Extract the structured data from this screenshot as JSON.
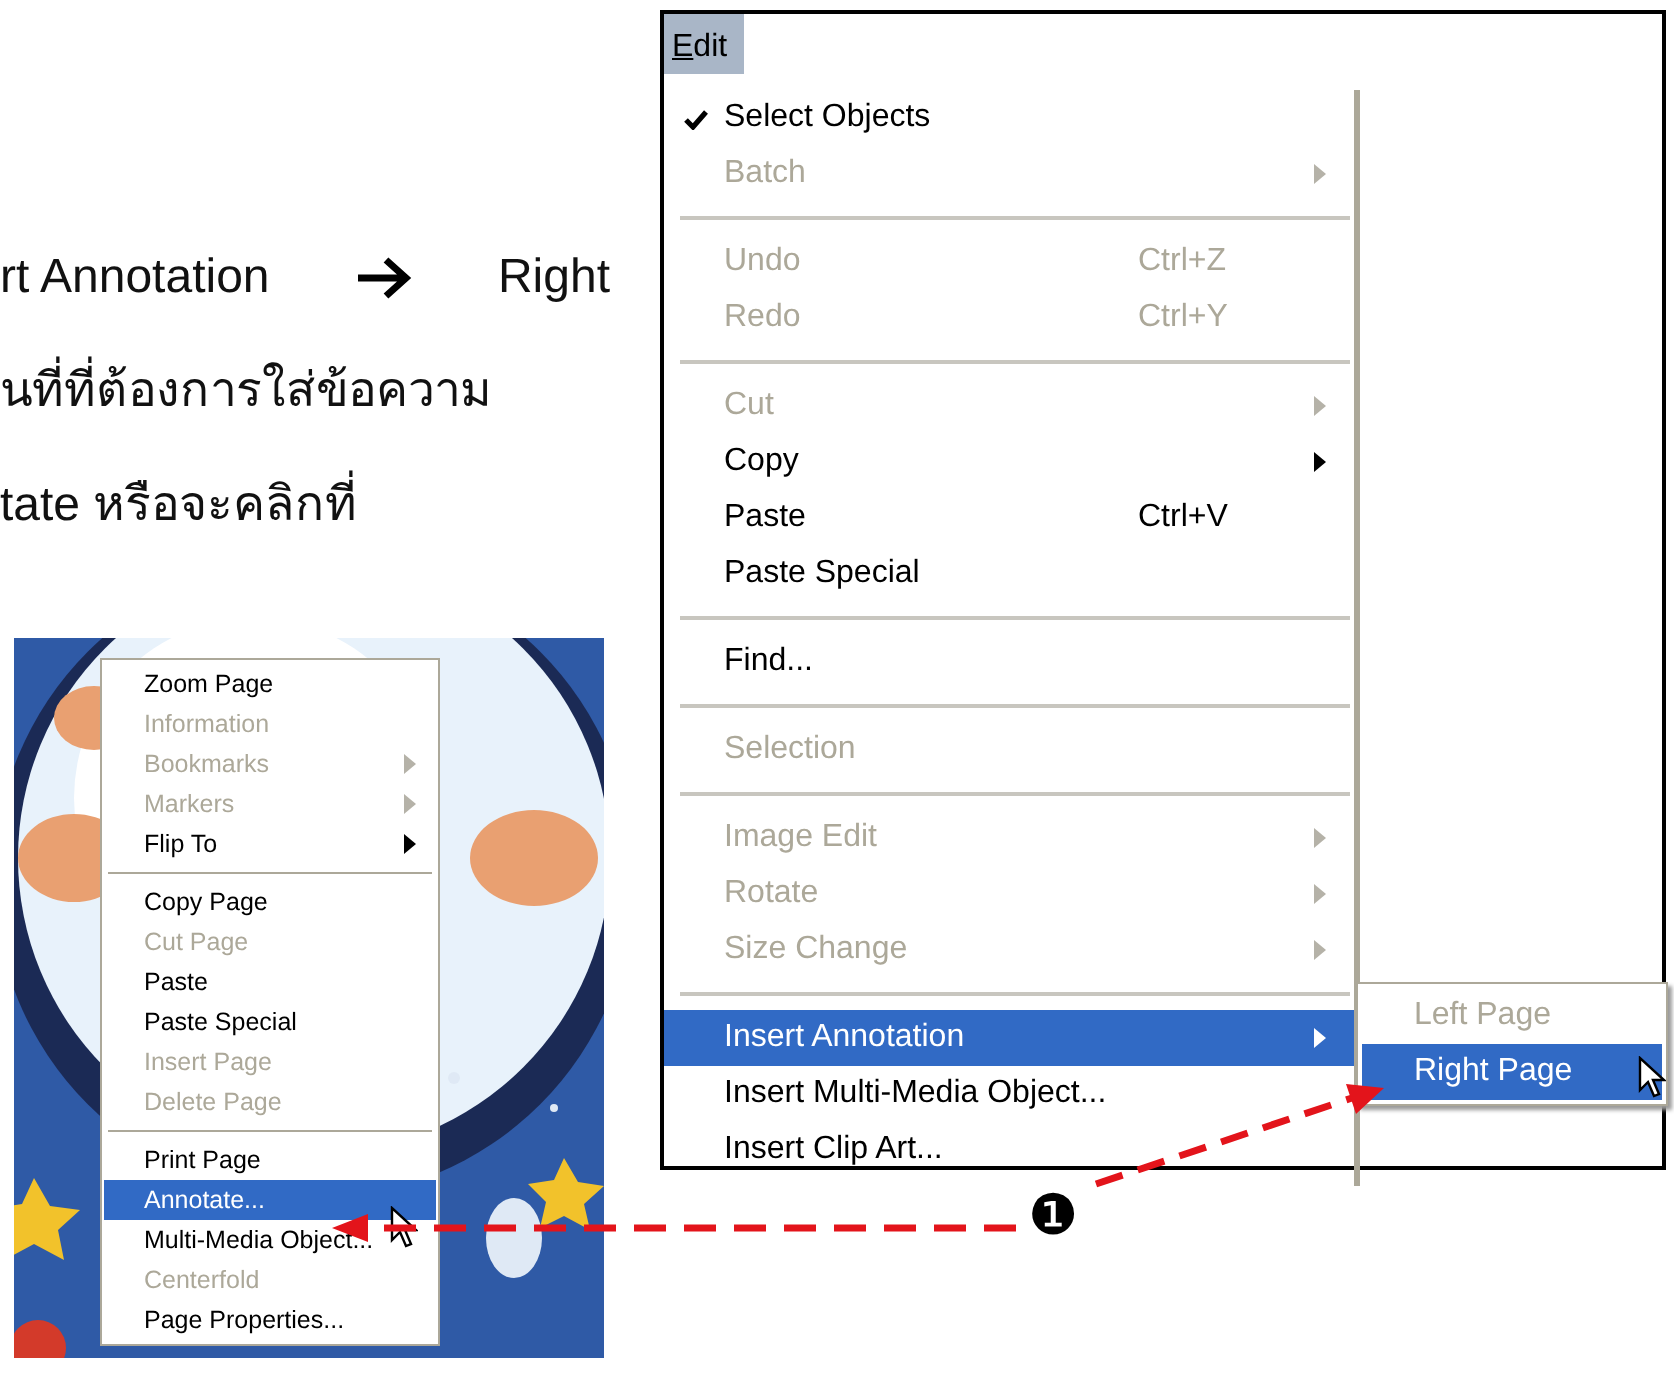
{
  "instructions": {
    "line_1_start": "rt Annotation",
    "line_1_end": "Right",
    "line_2": "นที่ที่ต้องการใส่ข้อความ",
    "line_3": "tate หรือจะคลิกที่"
  },
  "context_menu": {
    "items": [
      {
        "kind": "item",
        "label": "Zoom Page",
        "disabled": false,
        "selected": false,
        "submenu": false
      },
      {
        "kind": "item",
        "label": "Information",
        "disabled": true,
        "selected": false,
        "submenu": false
      },
      {
        "kind": "item",
        "label": "Bookmarks",
        "disabled": true,
        "selected": false,
        "submenu": true
      },
      {
        "kind": "item",
        "label": "Markers",
        "disabled": true,
        "selected": false,
        "submenu": true
      },
      {
        "kind": "item",
        "label": "Flip To",
        "disabled": false,
        "selected": false,
        "submenu": true
      },
      {
        "kind": "separator"
      },
      {
        "kind": "item",
        "label": "Copy Page",
        "disabled": false,
        "selected": false,
        "submenu": false
      },
      {
        "kind": "item",
        "label": "Cut Page",
        "disabled": true,
        "selected": false,
        "submenu": false
      },
      {
        "kind": "item",
        "label": "Paste",
        "disabled": false,
        "selected": false,
        "submenu": false
      },
      {
        "kind": "item",
        "label": "Paste Special",
        "disabled": false,
        "selected": false,
        "submenu": false
      },
      {
        "kind": "item",
        "label": "Insert Page",
        "disabled": true,
        "selected": false,
        "submenu": false
      },
      {
        "kind": "item",
        "label": "Delete Page",
        "disabled": true,
        "selected": false,
        "submenu": false
      },
      {
        "kind": "separator"
      },
      {
        "kind": "item",
        "label": "Print Page",
        "disabled": false,
        "selected": false,
        "submenu": false
      },
      {
        "kind": "item",
        "label": "Annotate...",
        "disabled": false,
        "selected": true,
        "submenu": false
      },
      {
        "kind": "item",
        "label": "Multi-Media Object...",
        "disabled": false,
        "selected": false,
        "submenu": false
      },
      {
        "kind": "item",
        "label": "Centerfold",
        "disabled": true,
        "selected": false,
        "submenu": false
      },
      {
        "kind": "item",
        "label": "Page Properties...",
        "disabled": false,
        "selected": false,
        "submenu": false
      }
    ]
  },
  "menu_bar": [
    {
      "label": "Edit",
      "selected": true
    }
  ],
  "edit_menu": {
    "items": [
      {
        "kind": "item",
        "label": "Select Objects",
        "checked": true,
        "disabled": false,
        "selected": false,
        "submenu": false
      },
      {
        "kind": "item",
        "label": "Batch",
        "checked": false,
        "disabled": true,
        "selected": false,
        "submenu": true
      },
      {
        "kind": "separator"
      },
      {
        "kind": "item",
        "label": "Undo",
        "shortcut": "Ctrl+Z",
        "checked": false,
        "disabled": true,
        "selected": false,
        "submenu": false
      },
      {
        "kind": "item",
        "label": "Redo",
        "shortcut": "Ctrl+Y",
        "checked": false,
        "disabled": true,
        "selected": false,
        "submenu": false
      },
      {
        "kind": "separator"
      },
      {
        "kind": "item",
        "label": "Cut",
        "checked": false,
        "disabled": true,
        "selected": false,
        "submenu": true
      },
      {
        "kind": "item",
        "label": "Copy",
        "checked": false,
        "disabled": false,
        "selected": false,
        "submenu": true
      },
      {
        "kind": "item",
        "label": "Paste",
        "shortcut": "Ctrl+V",
        "checked": false,
        "disabled": false,
        "selected": false,
        "submenu": false
      },
      {
        "kind": "item",
        "label": "Paste Special",
        "checked": false,
        "disabled": false,
        "selected": false,
        "submenu": false
      },
      {
        "kind": "separator"
      },
      {
        "kind": "item",
        "label": "Find...",
        "checked": false,
        "disabled": false,
        "selected": false,
        "submenu": false
      },
      {
        "kind": "separator"
      },
      {
        "kind": "item",
        "label": "Selection",
        "checked": false,
        "disabled": true,
        "selected": false,
        "submenu": false
      },
      {
        "kind": "separator"
      },
      {
        "kind": "item",
        "label": "Image Edit",
        "checked": false,
        "disabled": true,
        "selected": false,
        "submenu": true
      },
      {
        "kind": "item",
        "label": "Rotate",
        "checked": false,
        "disabled": true,
        "selected": false,
        "submenu": true
      },
      {
        "kind": "item",
        "label": "Size Change",
        "checked": false,
        "disabled": true,
        "selected": false,
        "submenu": true
      },
      {
        "kind": "separator"
      },
      {
        "kind": "item",
        "label": "Insert Annotation",
        "checked": false,
        "disabled": false,
        "selected": true,
        "submenu": true
      },
      {
        "kind": "item",
        "label": "Insert Multi-Media Object...",
        "checked": false,
        "disabled": false,
        "selected": false,
        "submenu": false
      },
      {
        "kind": "item",
        "label": "Insert Clip Art...",
        "checked": false,
        "disabled": false,
        "selected": false,
        "submenu": false
      }
    ]
  },
  "annotation_submenu": {
    "items": [
      {
        "label": "Left Page",
        "disabled": true,
        "selected": false
      },
      {
        "label": "Right Page",
        "disabled": false,
        "selected": true
      }
    ]
  },
  "step_badge": "❶"
}
